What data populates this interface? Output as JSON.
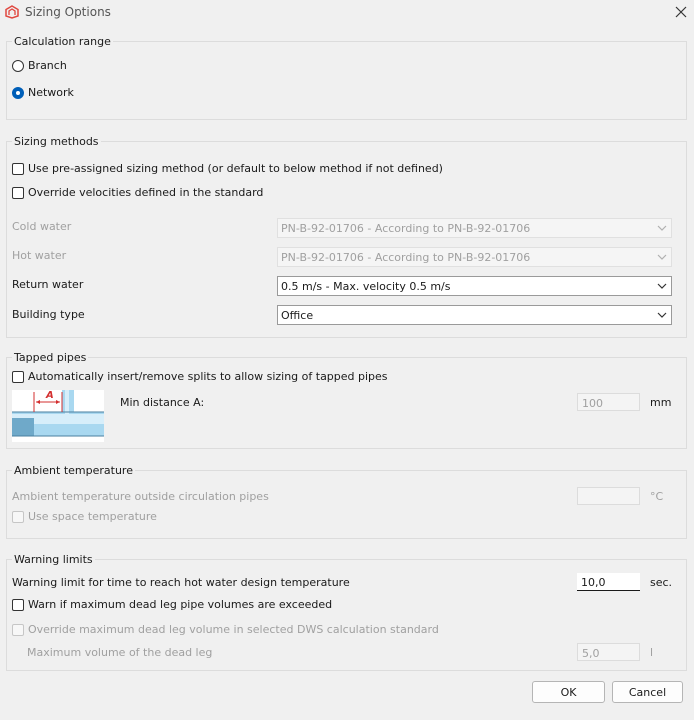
{
  "window": {
    "title": "Sizing Options"
  },
  "calc_range": {
    "label": "Calculation range",
    "branch": "Branch",
    "network": "Network",
    "selected": "Network"
  },
  "sizing_methods": {
    "label": "Sizing methods",
    "pre_assigned": "Use pre-assigned sizing method (or default to below method if not defined)",
    "override_vel": "Override velocities defined in the standard",
    "cold_label": "Cold water",
    "cold_value": "PN-B-92-01706 - According to PN-B-92-01706",
    "hot_label": "Hot water",
    "hot_value": "PN-B-92-01706 - According to PN-B-92-01706",
    "return_label": "Return water",
    "return_value": "0.5 m/s - Max. velocity 0.5 m/s",
    "building_label": "Building type",
    "building_value": "Office"
  },
  "tapped": {
    "label": "Tapped pipes",
    "auto_splits": "Automatically insert/remove splits to allow sizing of tapped pipes",
    "diagram_letter": "A",
    "min_dist_label": "Min distance A:",
    "min_dist_value": "100",
    "unit": "mm"
  },
  "ambient": {
    "label": "Ambient temperature",
    "outside_label": "Ambient temperature outside circulation pipes",
    "outside_value": "",
    "unit": "°C",
    "use_space": "Use space temperature"
  },
  "warning": {
    "label": "Warning limits",
    "time_label": "Warning limit for time to reach hot water design temperature",
    "time_value": "10,0",
    "time_unit": "sec.",
    "dead_leg": "Warn if maximum dead leg pipe volumes are exceeded",
    "override_dead": "Override maximum dead leg volume in selected DWS calculation standard",
    "max_vol_label": "Maximum volume of the dead leg",
    "max_vol_value": "5,0",
    "max_vol_unit": "l"
  },
  "buttons": {
    "ok": "OK",
    "cancel": "Cancel"
  },
  "colors": {
    "accent": "#005fb8",
    "brand_icon": "#e0473f",
    "pipe": "#a9d8f0"
  },
  "icons": [
    "app-logo-icon",
    "close-icon",
    "chevron-down-icon"
  ]
}
